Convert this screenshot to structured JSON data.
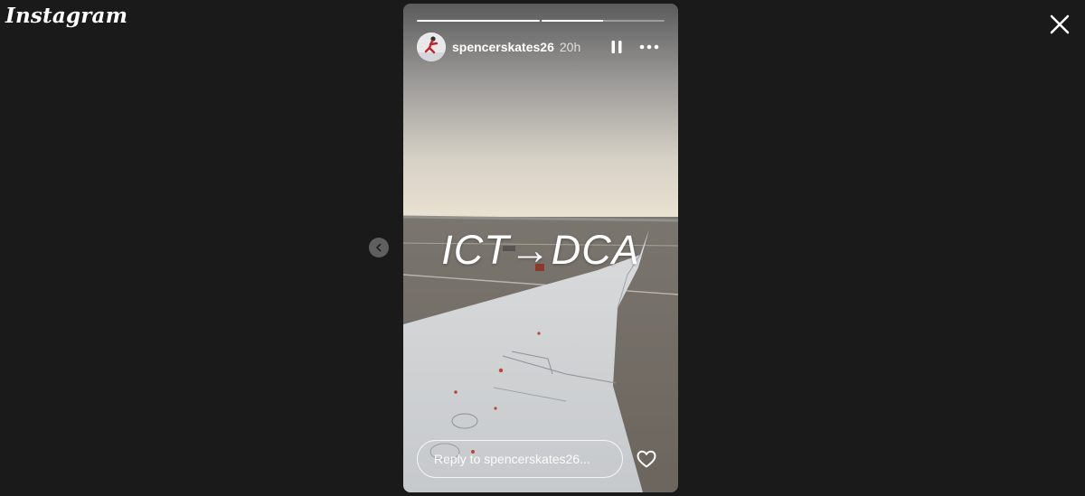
{
  "app": {
    "logo_text": "Instagram"
  },
  "story": {
    "segments": [
      1.0,
      0.5
    ],
    "username": "spencerskates26",
    "time": "20h",
    "overlay_text": "ICT→DCA",
    "reply_placeholder": "Reply to spencerskates26..."
  },
  "icons": {
    "close": "close-icon",
    "pause": "pause-icon",
    "more": "more-options-icon",
    "heart": "heart-icon",
    "prev": "chevron-left-icon"
  }
}
